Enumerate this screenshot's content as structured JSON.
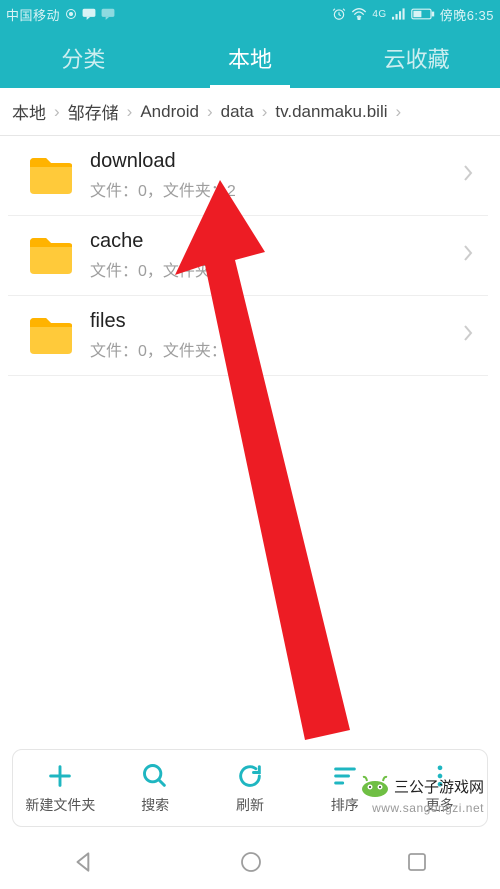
{
  "status": {
    "carrier": "中国移动",
    "location_icon": "location",
    "net_badge": "4G",
    "time": "傍晚6:35"
  },
  "tabs": [
    {
      "label": "分类",
      "active": false
    },
    {
      "label": "本地",
      "active": true
    },
    {
      "label": "云收藏",
      "active": false
    }
  ],
  "breadcrumb": [
    "本地",
    "邹存储",
    "Android",
    "data",
    "tv.danmaku.bili"
  ],
  "list": [
    {
      "name": "download",
      "sub": "文件：0，文件夹：2"
    },
    {
      "name": "cache",
      "sub": "文件：0，文件夹：4"
    },
    {
      "name": "files",
      "sub": "文件：0，文件夹：6"
    }
  ],
  "bottom": [
    {
      "icon": "plus",
      "label": "新建文件夹"
    },
    {
      "icon": "search",
      "label": "搜索"
    },
    {
      "icon": "refresh",
      "label": "刷新"
    },
    {
      "icon": "sort",
      "label": "排序"
    },
    {
      "icon": "more",
      "label": "更多"
    }
  ],
  "watermark": {
    "brand": "三公子游戏网",
    "url": "www.sangongzi.net"
  }
}
